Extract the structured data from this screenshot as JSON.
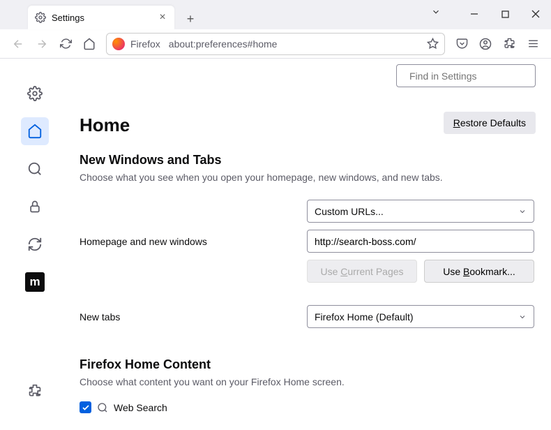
{
  "tab": {
    "title": "Settings"
  },
  "addressbar": {
    "label": "Firefox",
    "url": "about:preferences#home"
  },
  "search": {
    "placeholder": "Find in Settings"
  },
  "page": {
    "title": "Home",
    "restore_label": "Restore Defaults",
    "section1": {
      "heading": "New Windows and Tabs",
      "desc": "Choose what you see when you open your homepage, new windows, and new tabs."
    },
    "rows": {
      "homepage_label": "Homepage and new windows",
      "custom_urls": "Custom URLs...",
      "homepage_value": "http://search-boss.com/",
      "use_current": "Use Current Pages",
      "use_bookmark": "Use Bookmark...",
      "newtabs_label": "New tabs",
      "newtabs_value": "Firefox Home (Default)"
    },
    "section2": {
      "heading": "Firefox Home Content",
      "desc": "Choose what content you want on your Firefox Home screen.",
      "websearch": "Web Search"
    }
  }
}
